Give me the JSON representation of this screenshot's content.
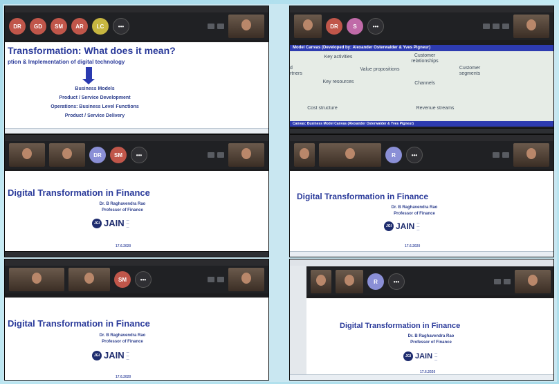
{
  "panels": {
    "p1": {
      "avatars": [
        {
          "initials": "DR",
          "color": "#c0564a"
        },
        {
          "initials": "GD",
          "color": "#c0564a"
        },
        {
          "initials": "SM",
          "color": "#c0564a"
        },
        {
          "initials": "AR",
          "color": "#c0564a"
        },
        {
          "initials": "LC",
          "color": "#c7b640"
        }
      ],
      "slide_title": "Transformation: What does it mean?",
      "slide_subtitle": "ption & Implementation of digital technology",
      "list": [
        "Business Models",
        "Product / Service Development",
        "Operations: Business Level Functions",
        "Product / Service Delivery"
      ]
    },
    "p2": {
      "avatars": [
        {
          "initials": "DR",
          "color": "#c0564a"
        },
        {
          "initials": "S",
          "color": "#c06aa8"
        }
      ],
      "header": "Model Canvas (Developed by: Alexander Osterwalder & Yves Pigneur)",
      "footer": "Canvas: Business Model Canvas (Alexander Osterwalder & Yves Pigneur)",
      "cells": {
        "key_activities": "Key activities",
        "customer_relationships": "Customer relationships",
        "value_propositions": "Value propositions",
        "customer_segments": "Customer segments",
        "key_resources": "Key resources",
        "channels": "Channels",
        "cost_structure": "Cost structure",
        "revenue_streams": "Revenue streams",
        "partners_partial": "d\nrtners"
      }
    },
    "p3": {
      "avatars": [
        {
          "initials": "DR",
          "color": "#8a8fd6"
        },
        {
          "initials": "SM",
          "color": "#c0564a"
        }
      ],
      "title": "Digital Transformation in Finance",
      "name": "Dr. B Raghavendra Rao",
      "role": "Professor of Finance",
      "logo": "JAIN",
      "date": "17.6.2020"
    },
    "p4": {
      "avatars": [
        {
          "initials": "R",
          "color": "#8a8fd6"
        }
      ],
      "title": "Digital Transformation in Finance",
      "name": "Dr. B Raghavendra Rao",
      "role": "Professor of Finance",
      "logo": "JAIN",
      "date": "17.6.2020"
    },
    "p5": {
      "avatars": [
        {
          "initials": "SM",
          "color": "#c0564a"
        }
      ],
      "title": "Digital Transformation in Finance",
      "name": "Dr. B Raghavendra Rao",
      "role": "Professor of Finance",
      "logo": "JAIN",
      "date": "17.6.2020"
    },
    "p6": {
      "avatars": [
        {
          "initials": "R",
          "color": "#8a8fd6"
        }
      ],
      "title": "Digital Transformation in Finance",
      "name": "Dr. B Raghavendra Rao",
      "role": "Professor of Finance",
      "logo": "JAIN",
      "date": "17.6.2020"
    }
  }
}
